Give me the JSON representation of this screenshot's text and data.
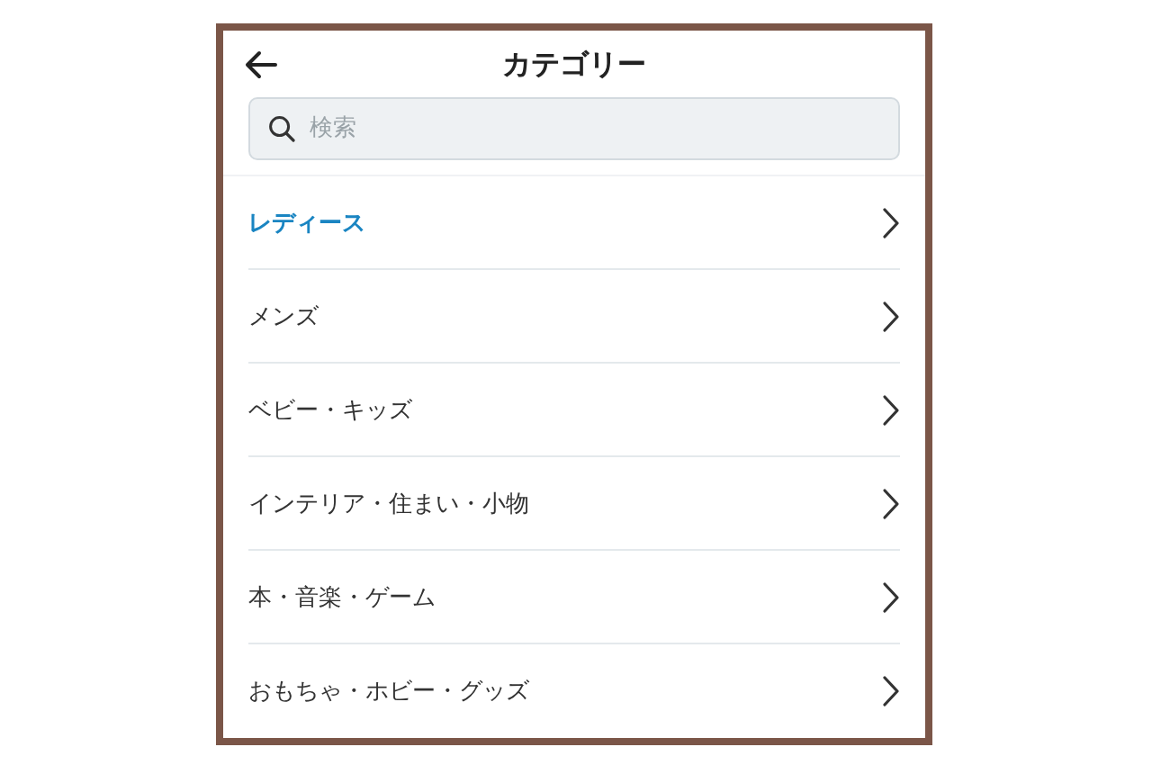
{
  "header": {
    "title": "カテゴリー"
  },
  "search": {
    "placeholder": "検索"
  },
  "categories": [
    {
      "label": "レディース",
      "selected": true
    },
    {
      "label": "メンズ",
      "selected": false
    },
    {
      "label": "ベビー・キッズ",
      "selected": false
    },
    {
      "label": "インテリア・住まい・小物",
      "selected": false
    },
    {
      "label": "本・音楽・ゲーム",
      "selected": false
    },
    {
      "label": "おもちゃ・ホビー・グッズ",
      "selected": false
    }
  ]
}
